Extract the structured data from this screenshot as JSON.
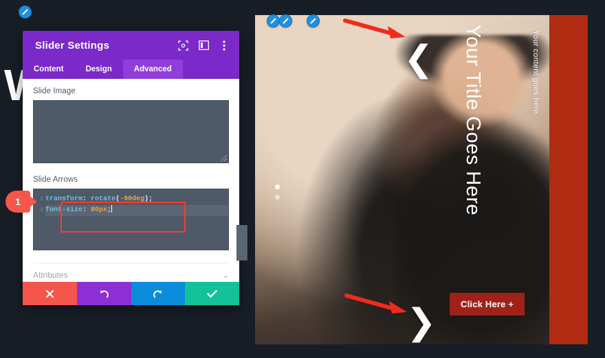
{
  "background": {
    "letter": "W"
  },
  "modal": {
    "title": "Slider Settings",
    "header_icons": [
      {
        "name": "fullscreen-icon",
        "label": "Fullscreen"
      },
      {
        "name": "split-view-icon",
        "label": "Split View"
      },
      {
        "name": "more-options-icon",
        "label": "More Options"
      }
    ],
    "tabs": [
      {
        "label": "Content",
        "active": false
      },
      {
        "label": "Design",
        "active": false
      },
      {
        "label": "Advanced",
        "active": true
      }
    ],
    "fields": [
      {
        "label": "Slide Image",
        "value": ""
      },
      {
        "label": "Slide Arrows"
      }
    ],
    "slide_arrows_code": {
      "lines": [
        {
          "number": "1",
          "property": "transform",
          "colon": ":",
          "fn": "rotate",
          "open": "(",
          "value": "-90deg",
          "close": ")",
          "semi": ";"
        },
        {
          "number": "2",
          "property": "font-size",
          "colon": ":",
          "value": "80px",
          "semi": ";"
        }
      ]
    },
    "attributes": {
      "label": "Attributes",
      "chevron": "⌄"
    },
    "footer_buttons": [
      {
        "name": "cancel-button",
        "glyph": "✕",
        "color": "#f5554a"
      },
      {
        "name": "undo-button",
        "glyph": "↺",
        "color": "#8e2fd6"
      },
      {
        "name": "redo-button",
        "glyph": "↻",
        "color": "#0c8ddb"
      },
      {
        "name": "save-button",
        "glyph": "✔",
        "color": "#13c29a"
      }
    ]
  },
  "annotation": {
    "pin_number": "1"
  },
  "preview": {
    "title": "Your Title Goes Here",
    "content": "Your content goes here.",
    "cta_label": "Click Here +",
    "prev_arrow": "❮",
    "next_arrow": "❯",
    "dots": [
      {
        "active": true
      },
      {
        "active": false
      }
    ],
    "accent_color": "#b02b11",
    "cta_color": "#9e2218"
  }
}
